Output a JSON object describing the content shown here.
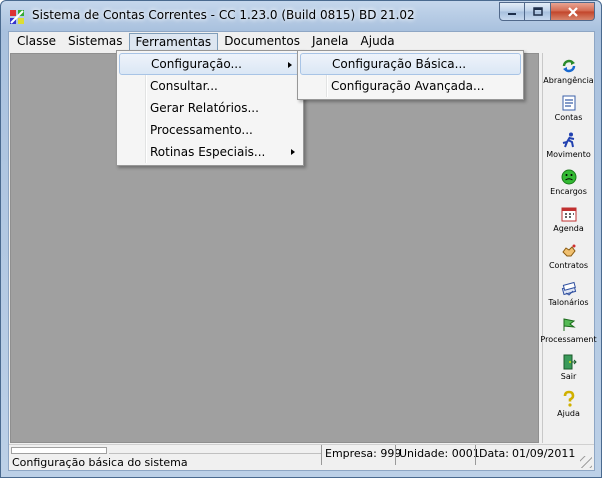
{
  "window": {
    "title": "Sistema de Contas Correntes - CC 1.23.0 (Build 0815) BD 21.02",
    "app_icon": "app-icon",
    "controls": [
      "minimize-icon",
      "maximize-icon",
      "close-icon"
    ]
  },
  "menubar": {
    "items": [
      "Classe",
      "Sistemas",
      "Ferramentas",
      "Documentos",
      "Janela",
      "Ajuda"
    ],
    "open_index": 2
  },
  "ferramentas_menu": {
    "items": [
      {
        "label": "Configuração...",
        "submenu": true
      },
      {
        "label": "Consultar...",
        "submenu": false
      },
      {
        "label": "Gerar Relatórios...",
        "submenu": false
      },
      {
        "label": "Processamento...",
        "submenu": false
      },
      {
        "label": "Rotinas Especiais...",
        "submenu": true
      }
    ]
  },
  "config_submenu": {
    "items": [
      "Configuração Básica...",
      "Configuração Avançada..."
    ]
  },
  "toolbar": {
    "items": [
      {
        "label": "Abrangência",
        "icon": "refresh-arrows-icon",
        "color": "#2a8a2a"
      },
      {
        "label": "Contas",
        "icon": "document-list-icon",
        "color": "#3a5fa8"
      },
      {
        "label": "Movimento",
        "icon": "running-man-icon",
        "color": "#2040b0"
      },
      {
        "label": "Encargos",
        "icon": "green-face-icon",
        "color": "#22aa22"
      },
      {
        "label": "Agenda",
        "icon": "calendar-icon",
        "color": "#c03030"
      },
      {
        "label": "Contratos",
        "icon": "handshake-icon",
        "color": "#c08020"
      },
      {
        "label": "Talonários",
        "icon": "checkbook-icon",
        "color": "#3050a0"
      },
      {
        "label": "Processament",
        "icon": "process-flag-icon",
        "color": "#2a8a2a"
      },
      {
        "label": "Sair",
        "icon": "exit-door-icon",
        "color": "#20803a"
      },
      {
        "label": "Ajuda",
        "icon": "question-icon",
        "color": "#d0b000"
      }
    ]
  },
  "statusbar": {
    "message": "Configuração básica do sistema",
    "empresa": "Empresa: 999",
    "unidade": "Unidade: 0001",
    "data_label": "Data:",
    "data_value": "01/09/2011"
  }
}
